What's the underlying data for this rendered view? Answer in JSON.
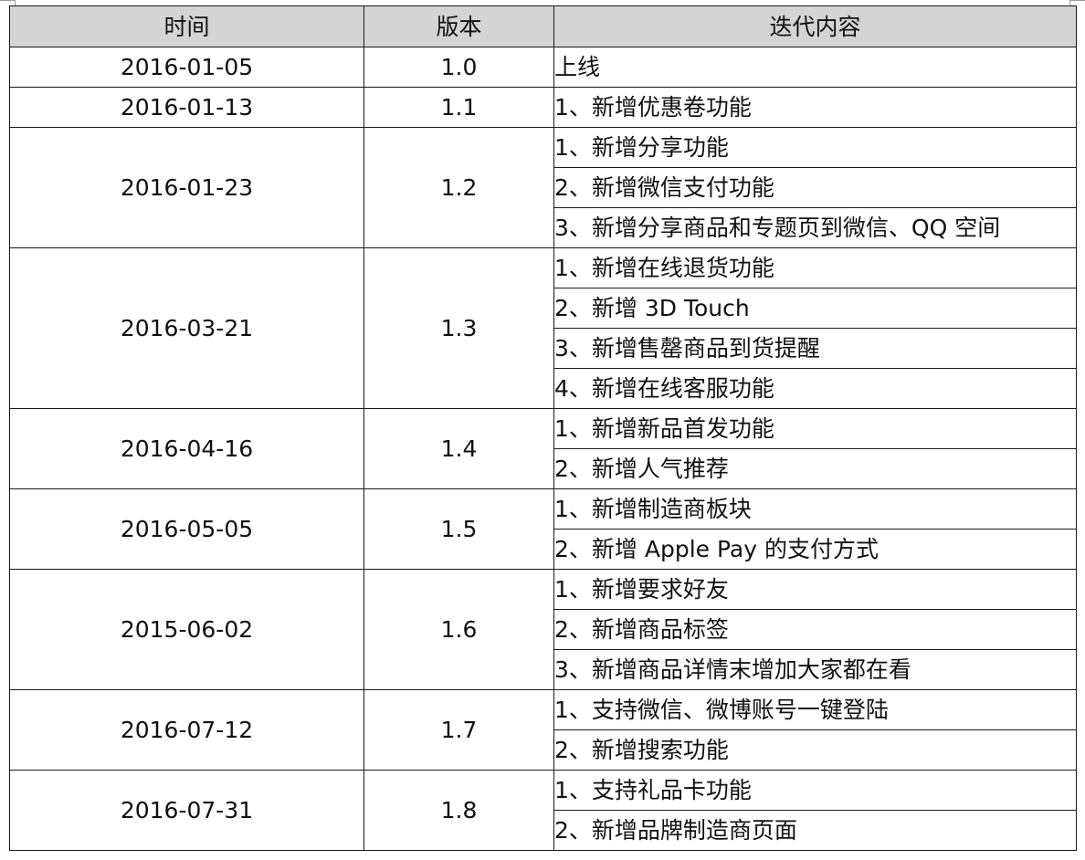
{
  "table": {
    "headers": {
      "date": "时间",
      "version": "版本",
      "content": "迭代内容"
    },
    "releases": [
      {
        "date": "2016-01-05",
        "version": "1.0",
        "items": [
          "上线"
        ]
      },
      {
        "date": "2016-01-13",
        "version": "1.1",
        "items": [
          "1、新增优惠卷功能"
        ]
      },
      {
        "date": "2016-01-23",
        "version": "1.2",
        "items": [
          "1、新增分享功能",
          "2、新增微信支付功能",
          "3、新增分享商品和专题页到微信、QQ 空间"
        ]
      },
      {
        "date": "2016-03-21",
        "version": "1.3",
        "items": [
          "1、新增在线退货功能",
          "2、新增 3D Touch",
          "3、新增售罄商品到货提醒",
          "4、新增在线客服功能"
        ]
      },
      {
        "date": "2016-04-16",
        "version": "1.4",
        "items": [
          "1、新增新品首发功能",
          "2、新增人气推荐"
        ]
      },
      {
        "date": "2016-05-05",
        "version": "1.5",
        "items": [
          "1、新增制造商板块",
          "2、新增 Apple Pay 的支付方式"
        ]
      },
      {
        "date": "2015-06-02",
        "version": "1.6",
        "items": [
          "1、新增要求好友",
          "2、新增商品标签",
          "3、新增商品详情末增加大家都在看"
        ]
      },
      {
        "date": "2016-07-12",
        "version": "1.7",
        "items": [
          "1、支持微信、微博账号一键登陆",
          "2、新增搜索功能"
        ]
      },
      {
        "date": "2016-07-31",
        "version": "1.8",
        "items": [
          "1、支持礼品卡功能",
          "2、新增品牌制造商页面"
        ]
      }
    ]
  }
}
